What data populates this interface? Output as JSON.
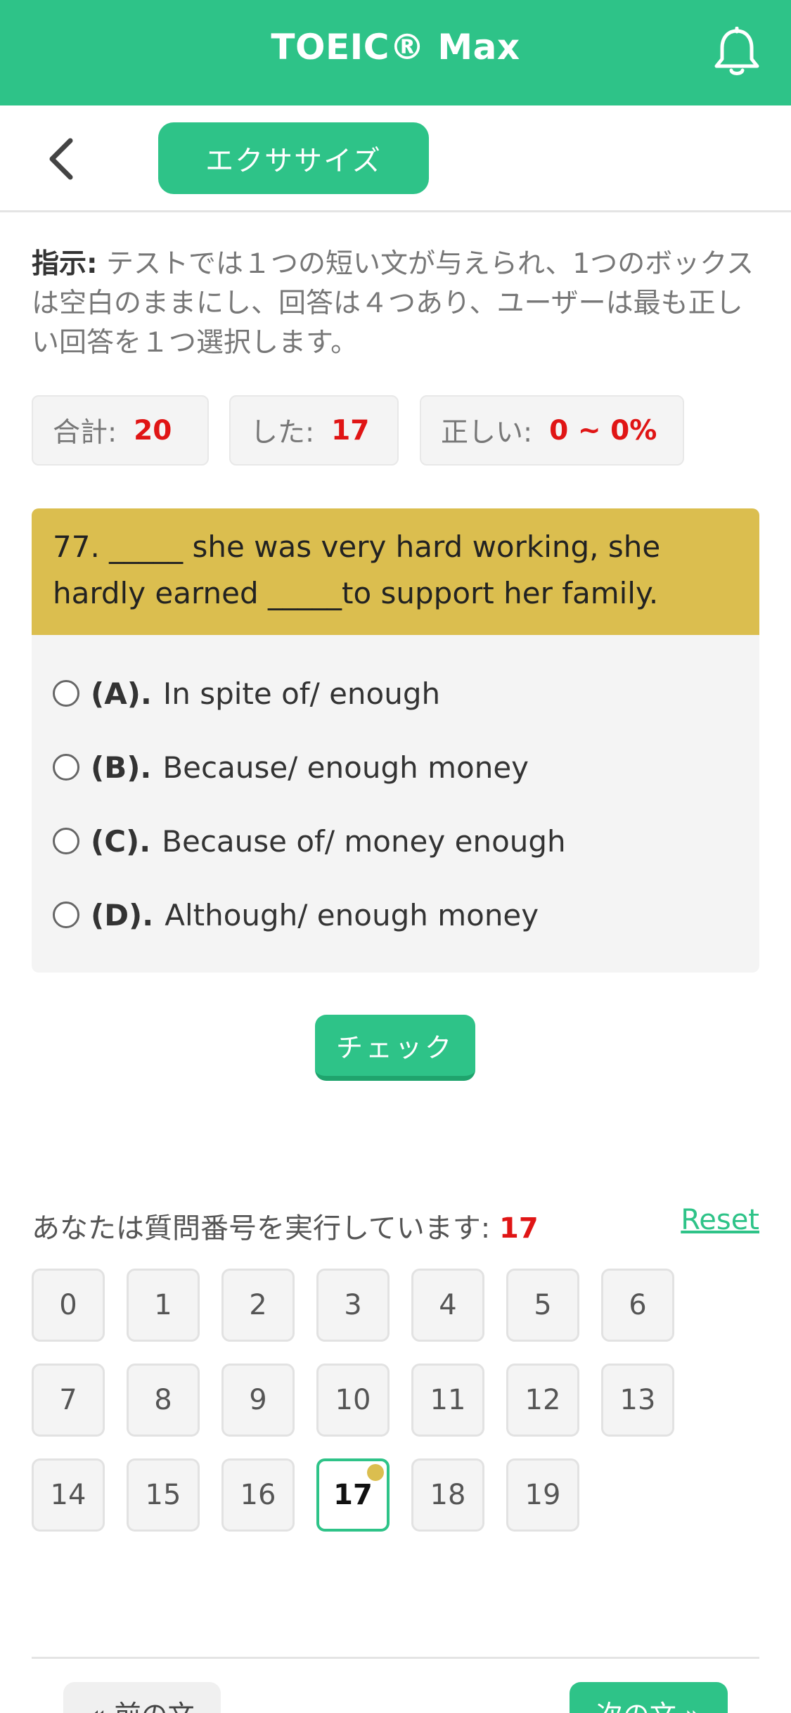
{
  "app": {
    "title": "TOEIC® Max"
  },
  "nav": {
    "tab_label": "エクササイズ"
  },
  "instructions": {
    "label": "指示:",
    "text": " テストでは１つの短い文が与えられ、1つのボックスは空白のままにし、回答は４つあり、ユーザーは最も正しい回答を１つ選択します。"
  },
  "stats": {
    "total_label": "合計:",
    "total_value": "20",
    "done_label": "した:",
    "done_value": "17",
    "correct_label": "正しい:",
    "correct_value": "0 ~ 0%"
  },
  "question": {
    "text": "77. _____ she was very hard working, she hardly earned _____to support her family.",
    "options": [
      {
        "key": "(A).",
        "text": "In spite of/ enough"
      },
      {
        "key": "(B).",
        "text": "Because/ enough money"
      },
      {
        "key": "(C).",
        "text": "Because of/ money enough"
      },
      {
        "key": "(D).",
        "text": "Although/ enough money"
      }
    ]
  },
  "check_label": "チェック",
  "progress": {
    "running_text": "あなたは質問番号を実行しています:",
    "current": "17",
    "reset_label": "Reset",
    "numbers": [
      "0",
      "1",
      "2",
      "3",
      "4",
      "5",
      "6",
      "7",
      "8",
      "9",
      "10",
      "11",
      "12",
      "13",
      "14",
      "15",
      "16",
      "17",
      "18",
      "19"
    ]
  },
  "footer": {
    "prev_label": "« 前の文",
    "next_label": "次の文 »"
  },
  "colors": {
    "accent": "#2ec388",
    "question_header": "#dbbe4f",
    "highlight_number": "#e01515"
  },
  "icons": {
    "bell": "bell-icon",
    "back": "chevron-left-icon"
  }
}
